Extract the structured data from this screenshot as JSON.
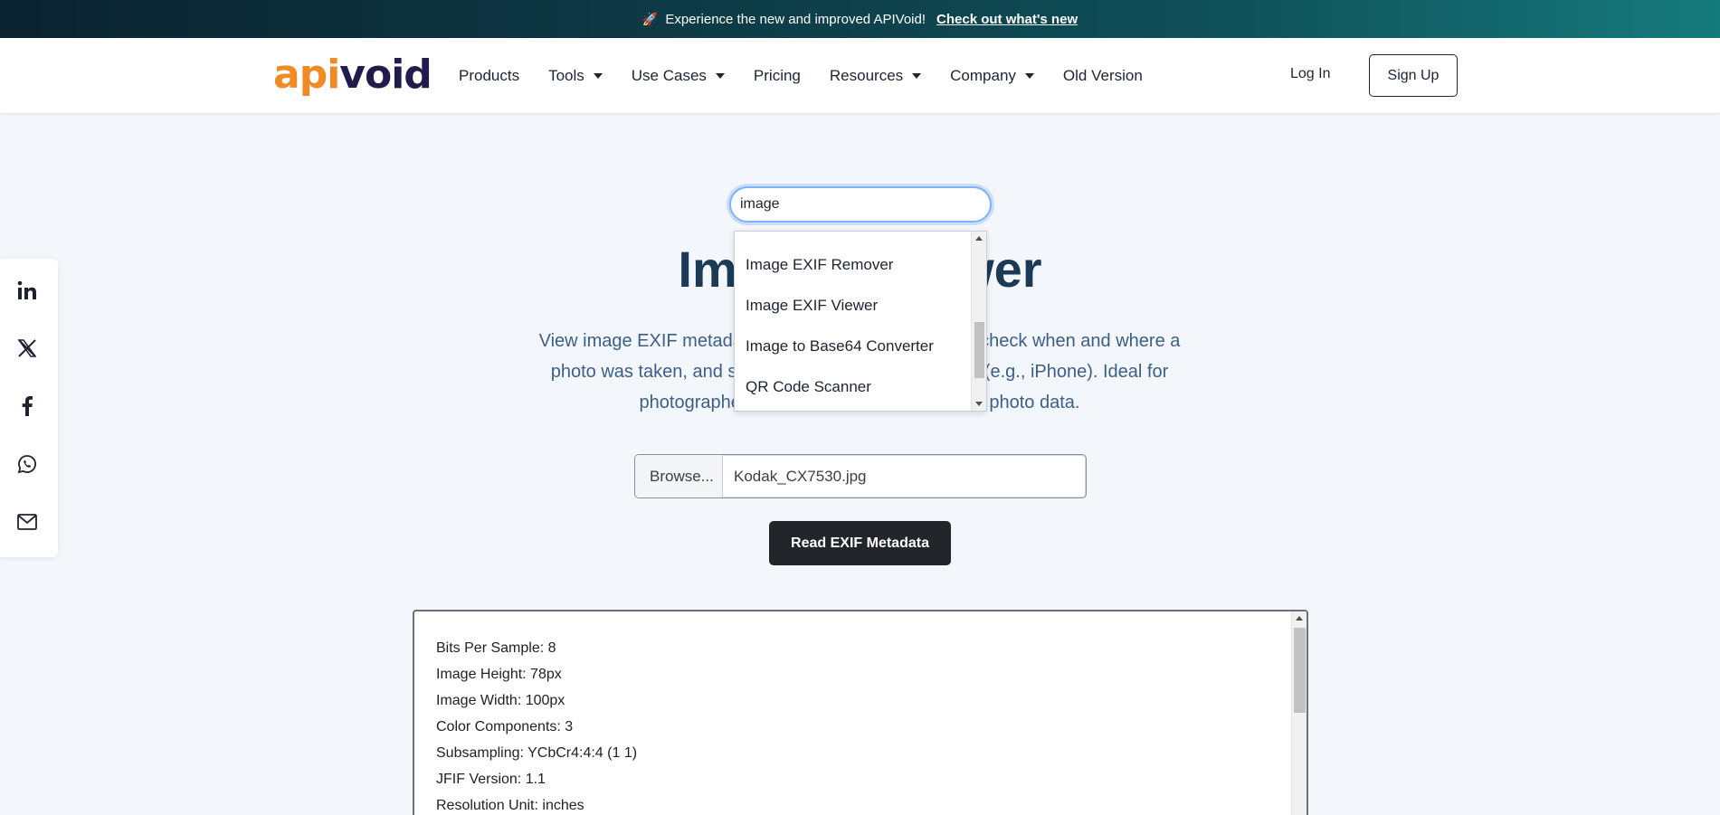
{
  "announcement": {
    "rocket": "🚀",
    "text": "Experience the new and improved APIVoid!",
    "link": "Check out what's new"
  },
  "brand": {
    "logo_part1": "api",
    "logo_part2": "void"
  },
  "nav": {
    "items": [
      {
        "label": "Products",
        "dropdown": false
      },
      {
        "label": "Tools",
        "dropdown": true
      },
      {
        "label": "Use Cases",
        "dropdown": true
      },
      {
        "label": "Pricing",
        "dropdown": false
      },
      {
        "label": "Resources",
        "dropdown": true
      },
      {
        "label": "Company",
        "dropdown": true
      },
      {
        "label": "Old Version",
        "dropdown": false
      }
    ],
    "login": "Log In",
    "signup": "Sign Up"
  },
  "social": [
    "linkedin-icon",
    "x-icon",
    "facebook-icon",
    "whatsapp-icon",
    "email-icon"
  ],
  "search": {
    "value": "image"
  },
  "dropdown": {
    "items": [
      "Image EXIF Remover",
      "Image EXIF Viewer",
      "Image to Base64 Converter",
      "QR Code Scanner"
    ]
  },
  "page": {
    "title_left": "Ima",
    "title_right": "ewer",
    "desc_line1_left": "View image EXIF metadata",
    "desc_line1_right": "y check when and where a",
    "desc_line2_left": "photo was taken, and see",
    "desc_line2_right": "el (e.g., iPhone). Ideal for",
    "desc_line3_left": "photographers,",
    "desc_line3_right": "ing photo data."
  },
  "file_input": {
    "browse_label": "Browse...",
    "filename": "Kodak_CX7530.jpg"
  },
  "read_button": "Read EXIF Metadata",
  "results": [
    "Bits Per Sample: 8",
    "Image Height: 78px",
    "Image Width: 100px",
    "Color Components: 3",
    "Subsampling: YCbCr4:4:4 (1 1)",
    "JFIF Version: 1.1",
    "Resolution Unit: inches"
  ],
  "colors": {
    "accent_orange": "#f08a24",
    "brand_dark": "#221c4c",
    "title": "#1b3a55",
    "desc": "#3c5f87",
    "button_dark": "#22262b"
  }
}
